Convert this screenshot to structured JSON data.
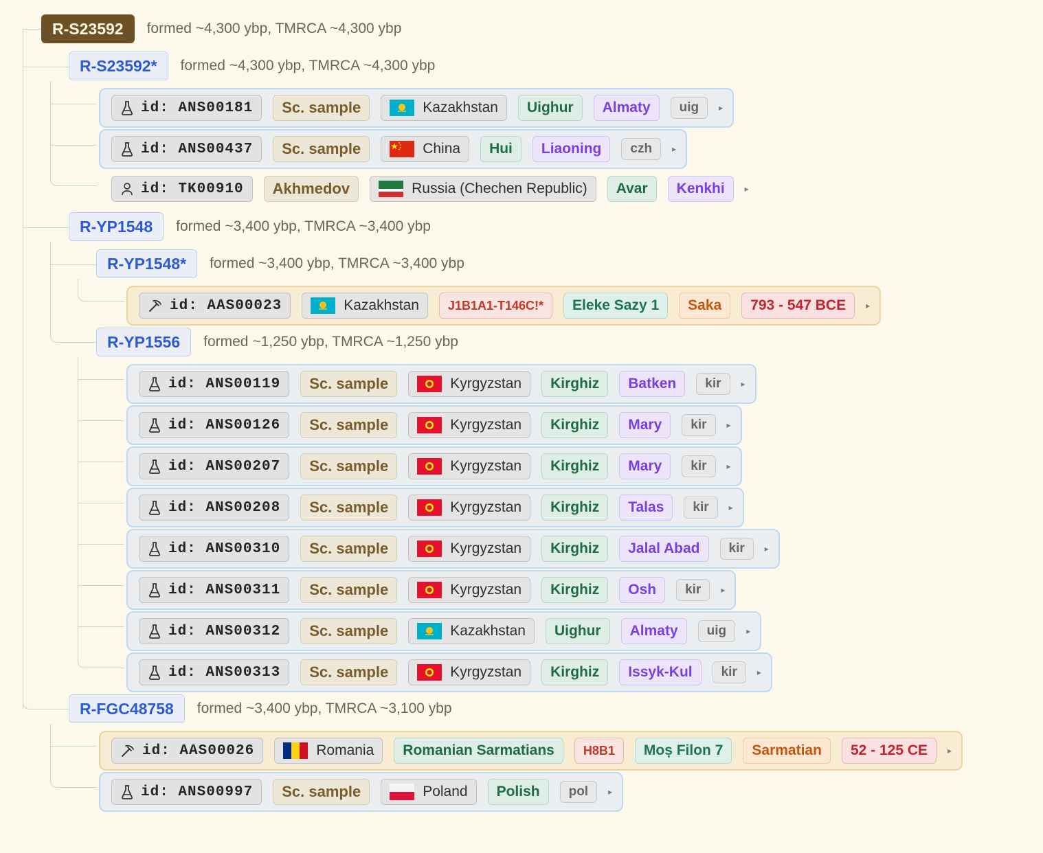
{
  "nodes": [
    {
      "haplogroup": "R-S23592",
      "meta": "formed ~4,300 ybp, TMRCA ~4,300 ybp"
    },
    {
      "haplogroup": "R-S23592*",
      "meta": "formed ~4,300 ybp, TMRCA ~4,300 ybp"
    },
    {
      "haplogroup": "R-YP1548",
      "meta": "formed ~3,400 ybp, TMRCA ~3,400 ybp"
    },
    {
      "haplogroup": "R-YP1548*",
      "meta": "formed ~3,400 ybp, TMRCA ~3,400 ybp"
    },
    {
      "haplogroup": "R-YP1556",
      "meta": "formed ~1,250 ybp, TMRCA ~1,250 ybp"
    },
    {
      "haplogroup": "R-FGC48758",
      "meta": "formed ~3,400 ybp, TMRCA ~3,100 ybp"
    }
  ],
  "samples": [
    {
      "id": "id: ANS00181",
      "kind": "flask-icon",
      "chips": [
        {
          "type": "sc",
          "text": "Sc. sample"
        },
        {
          "type": "country",
          "text": "Kazakhstan",
          "flag": "kz"
        },
        {
          "type": "ethnic",
          "text": "Uighur"
        },
        {
          "type": "region",
          "text": "Almaty"
        },
        {
          "type": "lang",
          "text": "uig"
        }
      ]
    },
    {
      "id": "id: ANS00437",
      "kind": "flask-icon",
      "chips": [
        {
          "type": "sc",
          "text": "Sc. sample"
        },
        {
          "type": "country",
          "text": "China",
          "flag": "cn"
        },
        {
          "type": "ethnic",
          "text": "Hui"
        },
        {
          "type": "region",
          "text": "Liaoning"
        },
        {
          "type": "lang",
          "text": "czh"
        }
      ]
    },
    {
      "id": "id: TK00910",
      "kind": "person-icon",
      "chips": [
        {
          "type": "sc",
          "text": "Akhmedov"
        },
        {
          "type": "country",
          "text": "Russia (Chechen Republic)",
          "flag": "ce"
        },
        {
          "type": "ethnic",
          "text": "Avar"
        },
        {
          "type": "region",
          "text": "Kenkhi"
        }
      ]
    },
    {
      "id": "id: AAS00023",
      "kind": "pickaxe-icon",
      "chips": [
        {
          "type": "country",
          "text": "Kazakhstan",
          "flag": "kz"
        },
        {
          "type": "mt",
          "text": "J1B1A1-T146C!*"
        },
        {
          "type": "site",
          "text": "Eleke Sazy 1"
        },
        {
          "type": "culture",
          "text": "Saka"
        },
        {
          "type": "date",
          "text": "793 - 547 BCE"
        }
      ]
    },
    {
      "id": "id: ANS00119",
      "kind": "flask-icon",
      "chips": [
        {
          "type": "sc",
          "text": "Sc. sample"
        },
        {
          "type": "country",
          "text": "Kyrgyzstan",
          "flag": "kg"
        },
        {
          "type": "ethnic",
          "text": "Kirghiz"
        },
        {
          "type": "region",
          "text": "Batken"
        },
        {
          "type": "lang",
          "text": "kir"
        }
      ]
    },
    {
      "id": "id: ANS00126",
      "kind": "flask-icon",
      "chips": [
        {
          "type": "sc",
          "text": "Sc. sample"
        },
        {
          "type": "country",
          "text": "Kyrgyzstan",
          "flag": "kg"
        },
        {
          "type": "ethnic",
          "text": "Kirghiz"
        },
        {
          "type": "region",
          "text": "Mary"
        },
        {
          "type": "lang",
          "text": "kir"
        }
      ]
    },
    {
      "id": "id: ANS00207",
      "kind": "flask-icon",
      "chips": [
        {
          "type": "sc",
          "text": "Sc. sample"
        },
        {
          "type": "country",
          "text": "Kyrgyzstan",
          "flag": "kg"
        },
        {
          "type": "ethnic",
          "text": "Kirghiz"
        },
        {
          "type": "region",
          "text": "Mary"
        },
        {
          "type": "lang",
          "text": "kir"
        }
      ]
    },
    {
      "id": "id: ANS00208",
      "kind": "flask-icon",
      "chips": [
        {
          "type": "sc",
          "text": "Sc. sample"
        },
        {
          "type": "country",
          "text": "Kyrgyzstan",
          "flag": "kg"
        },
        {
          "type": "ethnic",
          "text": "Kirghiz"
        },
        {
          "type": "region",
          "text": "Talas"
        },
        {
          "type": "lang",
          "text": "kir"
        }
      ]
    },
    {
      "id": "id: ANS00310",
      "kind": "flask-icon",
      "chips": [
        {
          "type": "sc",
          "text": "Sc. sample"
        },
        {
          "type": "country",
          "text": "Kyrgyzstan",
          "flag": "kg"
        },
        {
          "type": "ethnic",
          "text": "Kirghiz"
        },
        {
          "type": "region",
          "text": "Jalal Abad"
        },
        {
          "type": "lang",
          "text": "kir"
        }
      ]
    },
    {
      "id": "id: ANS00311",
      "kind": "flask-icon",
      "chips": [
        {
          "type": "sc",
          "text": "Sc. sample"
        },
        {
          "type": "country",
          "text": "Kyrgyzstan",
          "flag": "kg"
        },
        {
          "type": "ethnic",
          "text": "Kirghiz"
        },
        {
          "type": "region",
          "text": "Osh"
        },
        {
          "type": "lang",
          "text": "kir"
        }
      ]
    },
    {
      "id": "id: ANS00312",
      "kind": "flask-icon",
      "chips": [
        {
          "type": "sc",
          "text": "Sc. sample"
        },
        {
          "type": "country",
          "text": "Kazakhstan",
          "flag": "kz"
        },
        {
          "type": "ethnic",
          "text": "Uighur"
        },
        {
          "type": "region",
          "text": "Almaty"
        },
        {
          "type": "lang",
          "text": "uig"
        }
      ]
    },
    {
      "id": "id: ANS00313",
      "kind": "flask-icon",
      "chips": [
        {
          "type": "sc",
          "text": "Sc. sample"
        },
        {
          "type": "country",
          "text": "Kyrgyzstan",
          "flag": "kg"
        },
        {
          "type": "ethnic",
          "text": "Kirghiz"
        },
        {
          "type": "region",
          "text": "Issyk-Kul"
        },
        {
          "type": "lang",
          "text": "kir"
        }
      ]
    },
    {
      "id": "id: AAS00026",
      "kind": "pickaxe-icon",
      "chips": [
        {
          "type": "country",
          "text": "Romania",
          "flag": "ro"
        },
        {
          "type": "ethnic",
          "text": "Romanian Sarmatians"
        },
        {
          "type": "mt",
          "text": "H8B1"
        },
        {
          "type": "site",
          "text": "Moș Filon 7"
        },
        {
          "type": "culture",
          "text": "Sarmatian"
        },
        {
          "type": "date",
          "text": "52 - 125 CE"
        }
      ]
    },
    {
      "id": "id: ANS00997",
      "kind": "flask-icon",
      "chips": [
        {
          "type": "sc",
          "text": "Sc. sample"
        },
        {
          "type": "country",
          "text": "Poland",
          "flag": "pl"
        },
        {
          "type": "ethnic",
          "text": "Polish"
        },
        {
          "type": "lang",
          "text": "pol"
        }
      ]
    }
  ]
}
